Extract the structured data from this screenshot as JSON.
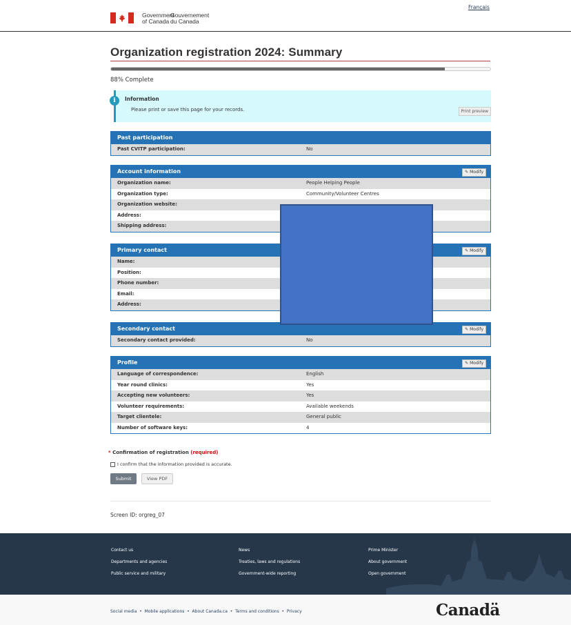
{
  "header": {
    "language_link": "Français",
    "gov_en_line1": "Government",
    "gov_en_line2": "of Canada",
    "gov_fr_line1": "Gouvernement",
    "gov_fr_line2": "du Canada"
  },
  "page": {
    "title": "Organization registration 2024: Summary",
    "progress_percent": 88,
    "progress_label": "88% Complete"
  },
  "alert": {
    "title": "Information",
    "message": "Please print or save this page for your records.",
    "print_label": "Print preview",
    "icon": "info-icon"
  },
  "panels": {
    "past": {
      "title": "Past participation",
      "rows": [
        {
          "k": "Past CVITP participation:",
          "v": "No"
        }
      ]
    },
    "account": {
      "title": "Account information",
      "modify": "Modify",
      "rows": [
        {
          "k": "Organization name:",
          "v": "People Helping People"
        },
        {
          "k": "Organization type:",
          "v": "Community/Volunteer Centres"
        },
        {
          "k": "Organization website:",
          "v": ""
        },
        {
          "k": "Address:",
          "v": ""
        },
        {
          "k": "Shipping address:",
          "v": ""
        }
      ]
    },
    "primary": {
      "title": "Primary contact",
      "modify": "Modify",
      "rows": [
        {
          "k": "Name:",
          "v": ""
        },
        {
          "k": "Position:",
          "v": ""
        },
        {
          "k": "Phone number:",
          "v": ""
        },
        {
          "k": "Email:",
          "v": ""
        },
        {
          "k": "Address:",
          "v": ""
        }
      ]
    },
    "secondary": {
      "title": "Secondary contact",
      "modify": "Modify",
      "rows": [
        {
          "k": "Secondary contact provided:",
          "v": "No"
        }
      ]
    },
    "profile": {
      "title": "Profile",
      "modify": "Modify",
      "rows": [
        {
          "k": "Language of correspondence:",
          "v": "English"
        },
        {
          "k": "Year round clinics:",
          "v": "Yes"
        },
        {
          "k": "Accepting new volunteers:",
          "v": "Yes"
        },
        {
          "k": "Volunteer requirements:",
          "v": "Available weekends"
        },
        {
          "k": "Target clientele:",
          "v": "General public"
        },
        {
          "k": "Number of software keys:",
          "v": "4"
        }
      ]
    }
  },
  "confirmation": {
    "asterisk": "*",
    "label": "Confirmation of registration",
    "required": "(required)",
    "checkbox_label": "I confirm that the information provided is accurate.",
    "submit": "Submit",
    "view_pdf": "View PDF"
  },
  "screen_id": "Screen ID: orgreg_07",
  "footer": {
    "col1": [
      "Contact us",
      "Departments and agencies",
      "Public service and military"
    ],
    "col2": [
      "News",
      "Treaties, laws and regulations",
      "Government-wide reporting"
    ],
    "col3": [
      "Prime Minister",
      "About government",
      "Open government"
    ],
    "bottom_links": [
      "Social media",
      "Mobile applications",
      "About Canada.ca",
      "Terms and conditions",
      "Privacy"
    ],
    "wordmark": "Canadä"
  },
  "colors": {
    "panel_header": "#2572b4",
    "footer_bg": "#26374a",
    "alert_bg": "#d7faff",
    "redaction": "#4472c4"
  }
}
